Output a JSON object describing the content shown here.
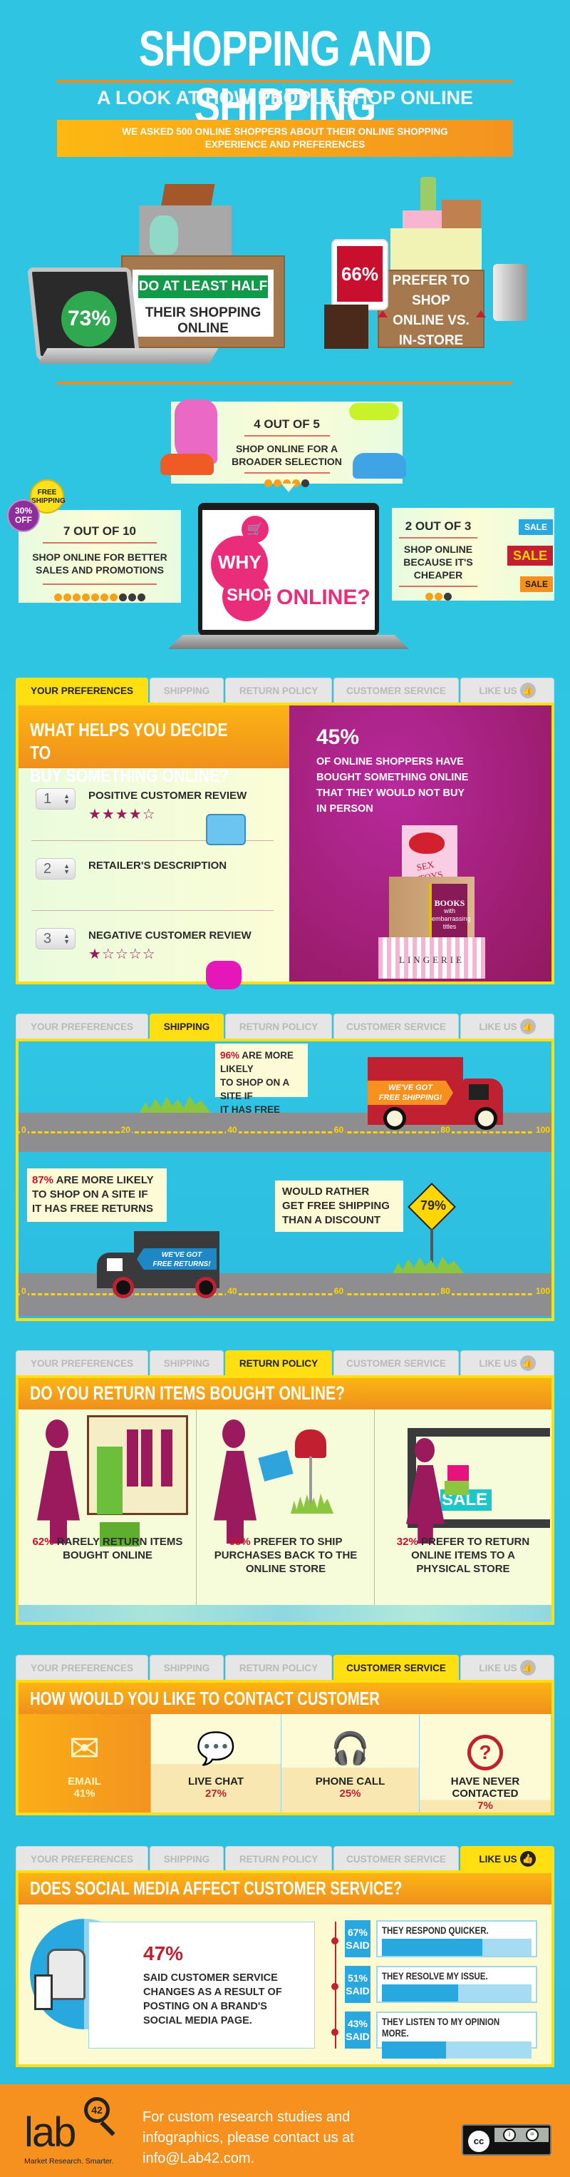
{
  "header": {
    "title": "SHOPPING AND SHIPPING",
    "subtitle": "A LOOK AT HOW PEOPLE SHOP ONLINE",
    "banner_line1": "WE ASKED 500 ONLINE SHOPPERS ABOUT THEIR ONLINE SHOPPING",
    "banner_line2": "EXPERIENCE AND PREFERENCES"
  },
  "hero": {
    "stat1_value": "73%",
    "stat1_line1": "DO AT LEAST HALF OF",
    "stat1_line2": "THEIR SHOPPING ONLINE",
    "stat2_value": "66%",
    "stat2_line1": "PREFER TO SHOP",
    "stat2_line2": "ONLINE VS.",
    "stat2_line3": "IN-STORE"
  },
  "why_shop": {
    "screen_word1": "WHY",
    "screen_word2": "SHOP",
    "screen_word3": "ONLINE?",
    "top": {
      "ratio": "4 OUT OF 5",
      "line1": "SHOP ONLINE FOR A",
      "line2": "BROADER SELECTION",
      "filled": 4,
      "total": 5
    },
    "left": {
      "ratio": "7 OUT OF 10",
      "line1": "SHOP ONLINE FOR BETTER",
      "line2": "SALES AND PROMOTIONS",
      "filled": 7,
      "total": 10
    },
    "right": {
      "ratio": "2 OUT OF 3",
      "line1": "SHOP ONLINE",
      "line2": "BECAUSE IT'S",
      "line3": "CHEAPER",
      "filled": 2,
      "total": 3
    },
    "badge_free_1": "FREE",
    "badge_free_2": "SHIPPING",
    "badge_off_1": "30%",
    "badge_off_2": "OFF",
    "sale_tags": [
      "SALE",
      "SALE",
      "SALE"
    ]
  },
  "tabs": [
    {
      "label": "YOUR PREFERENCES"
    },
    {
      "label": "SHIPPING"
    },
    {
      "label": "RETURN POLICY"
    },
    {
      "label": "CUSTOMER SERVICE"
    },
    {
      "label": "LIKE US"
    }
  ],
  "preferences": {
    "heading_line1": "WHAT HELPS YOU DECIDE TO",
    "heading_line2": "BUY SOMETHING ONLINE?",
    "ranks": [
      {
        "rank": "1",
        "label": "POSITIVE CUSTOMER REVIEW",
        "stars": "★★★★☆"
      },
      {
        "rank": "2",
        "label": "RETAILER'S DESCRIPTION",
        "stars": ""
      },
      {
        "rank": "3",
        "label": "NEGATIVE CUSTOMER REVIEW",
        "stars": "★☆☆☆☆"
      }
    ],
    "stat_value": "45%",
    "stat_line1": "OF ONLINE SHOPPERS HAVE",
    "stat_line2": "BOUGHT SOMETHING ONLINE",
    "stat_line3": "THAT THEY WOULD NOT BUY",
    "stat_line4": "IN PERSON",
    "item_sextoys": "SEX TOYS",
    "item_books_title": "BOOKS",
    "item_books_sub1": "with",
    "item_books_sub2": "embarrassing",
    "item_books_sub3": "titles",
    "item_lingerie": "LINGERIE"
  },
  "shipping": {
    "stat1_pct": "96%",
    "stat1_line1": " ARE MORE LIKELY",
    "stat1_line2": "TO SHOP ON A SITE IF",
    "stat1_line3": "IT HAS FREE SHIPPING",
    "truck1_line1": "WE'VE GOT",
    "truck1_line2": "FREE SHIPPING!",
    "stat2_pct": "87%",
    "stat2_line1": " ARE MORE LIKELY",
    "stat2_line2": "TO SHOP ON A SITE IF",
    "stat2_line3": "IT HAS FREE RETURNS",
    "truck2_line1": "WE'VE GOT",
    "truck2_line2": "FREE RETURNS!",
    "stat3_line1": "WOULD RATHER",
    "stat3_line2": "GET FREE SHIPPING",
    "stat3_line3": "THAN A DISCOUNT",
    "stat3_value": "79%",
    "road_ticks": [
      "0",
      "20",
      "40",
      "60",
      "80",
      "100"
    ]
  },
  "returns": {
    "heading": "DO YOU RETURN ITEMS BOUGHT ONLINE?",
    "items": [
      {
        "pct": "62%",
        "text1": " RARELY RETURN ITEMS",
        "text2": "BOUGHT ONLINE",
        "text3": ""
      },
      {
        "pct": "68%",
        "text1": " PREFER TO SHIP",
        "text2": "PURCHASES BACK TO THE",
        "text3": "ONLINE STORE"
      },
      {
        "pct": "32%",
        "text1": " PREFER TO RETURN",
        "text2": "ONLINE ITEMS TO A",
        "text3": "PHYSICAL STORE"
      }
    ],
    "sale_sign": "SALE"
  },
  "customer_service": {
    "heading": "HOW WOULD YOU LIKE TO CONTACT CUSTOMER SERVICE?",
    "options": [
      {
        "label": "EMAIL",
        "label2": "",
        "pct": "41%",
        "value": 41
      },
      {
        "label": "LIVE CHAT",
        "label2": "",
        "pct": "27%",
        "value": 27
      },
      {
        "label": "PHONE CALL",
        "label2": "",
        "pct": "25%",
        "value": 25
      },
      {
        "label": "HAVE NEVER",
        "label2": "CONTACTED",
        "pct": "7%",
        "value": 7
      }
    ]
  },
  "like_us": {
    "heading": "DOES SOCIAL MEDIA AFFECT CUSTOMER SERVICE?",
    "stat_value": "47%",
    "stat_line1": "SAID CUSTOMER SERVICE",
    "stat_line2": "CHANGES AS A RESULT OF",
    "stat_line3": "POSTING ON A BRAND'S",
    "stat_line4": "SOCIAL MEDIA PAGE.",
    "bars": [
      {
        "pct": "67%",
        "said": "SAID",
        "label": "THEY RESPOND QUICKER.",
        "value": 67
      },
      {
        "pct": "51%",
        "said": "SAID",
        "label": "THEY RESOLVE MY ISSUE.",
        "value": 51
      },
      {
        "pct": "43%",
        "said": "SAID",
        "label": "THEY LISTEN TO MY OPINION MORE.",
        "value": 43
      }
    ]
  },
  "footer": {
    "logo_text": "lab",
    "logo_num": "42",
    "tagline": "Market Research. Smarter.",
    "contact_line1": "For custom research studies and",
    "contact_line2": "infographics, please contact us at",
    "contact_line3": "info@Lab42.com.",
    "license": "CC BY-ND"
  },
  "colors": {
    "background": "#2ec4e2",
    "accent_orange": "#f6901e",
    "tab_active": "#ffdf11",
    "magenta": "#9b1a5e",
    "red": "#c0202f",
    "blue_bar": "#29a8e0"
  }
}
